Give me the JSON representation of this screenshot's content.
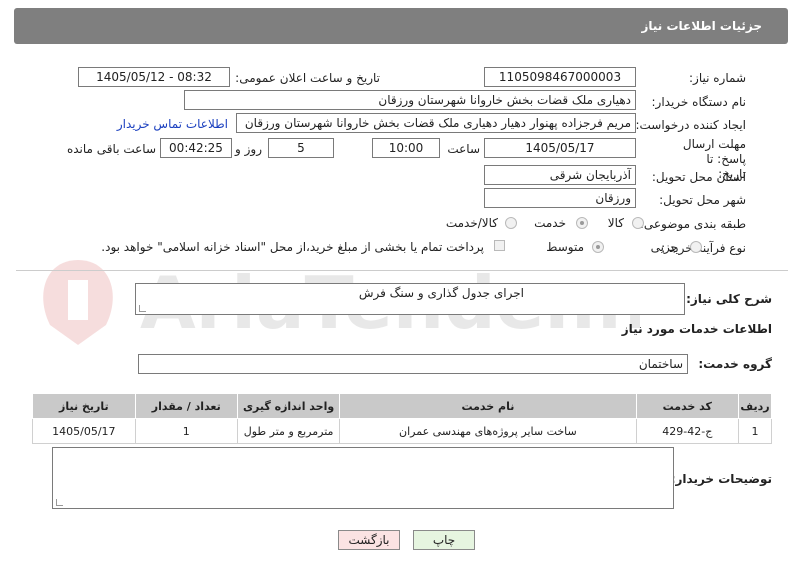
{
  "header": {
    "title": "جزئیات اطلاعات نیاز"
  },
  "labels": {
    "need_number": "شماره نیاز:",
    "announce_datetime": "تاریخ و ساعت اعلان عمومی:",
    "buyer_org": "نام دستگاه خریدار:",
    "requester": "ایجاد کننده درخواست:",
    "contact_link": "اطلاعات تماس خریدار",
    "deadline": "مهلت ارسال پاسخ: تا تاریخ:",
    "time": "ساعت",
    "days_and": "روز و",
    "remaining": "ساعت باقی مانده",
    "province": "استان محل تحویل:",
    "city": "شهر محل تحویل:",
    "category": "طبقه بندی موضوعی:",
    "purchase_type": "نوع فرآیند خرید :",
    "payment_note": "پرداخت تمام یا بخشی از مبلغ خرید،از محل \"اسناد خزانه اسلامی\" خواهد بود."
  },
  "fields": {
    "need_number": "1105098467000003",
    "announce_datetime": "1405/05/12 - 08:32",
    "buyer_org": "دهیاری ملک قضات بخش خاروانا شهرستان ورزقان",
    "requester": "مریم فرجزاده پهنوار دهیار دهیاری ملک قضات بخش خاروانا شهرستان ورزقان",
    "deadline_date": "1405/05/17",
    "deadline_time": "10:00",
    "days": "5",
    "remaining_time": "00:42:25",
    "province": "آذربایجان شرقی",
    "city": "ورزقان"
  },
  "category_options": [
    {
      "label": "کالا",
      "selected": false
    },
    {
      "label": "خدمت",
      "selected": true
    },
    {
      "label": "کالا/خدمت",
      "selected": false
    }
  ],
  "purchase_options": [
    {
      "label": "جزیی",
      "selected": false
    },
    {
      "label": "متوسط",
      "selected": true
    }
  ],
  "description": {
    "label": "شرح کلی نیاز:",
    "value": "اجرای جدول گذاری و سنگ فرش"
  },
  "services": {
    "section_title": "اطلاعات خدمات مورد نیاز",
    "group_label": "گروه خدمت:",
    "group_value": "ساختمان",
    "columns": [
      "ردیف",
      "کد خدمت",
      "نام خدمت",
      "واحد اندازه گیری",
      "تعداد / مقدار",
      "تاریخ نیاز"
    ],
    "rows": [
      [
        "1",
        "ج-42-429",
        "ساخت سایر پروژه‌های مهندسی عمران",
        "مترمربع و متر طول",
        "1",
        "1405/05/17"
      ]
    ]
  },
  "buyer_notes": {
    "label": "توضیحات خریدار:",
    "value": ""
  },
  "buttons": {
    "print": "چاپ",
    "back": "بازگشت"
  },
  "watermark": "AriaTender.net",
  "colors": {
    "header_bg": "#7f7f7f",
    "link": "#1a3fbf",
    "back_button_bg": "#fbe3e3",
    "print_button_bg": "#e6f5e0"
  }
}
